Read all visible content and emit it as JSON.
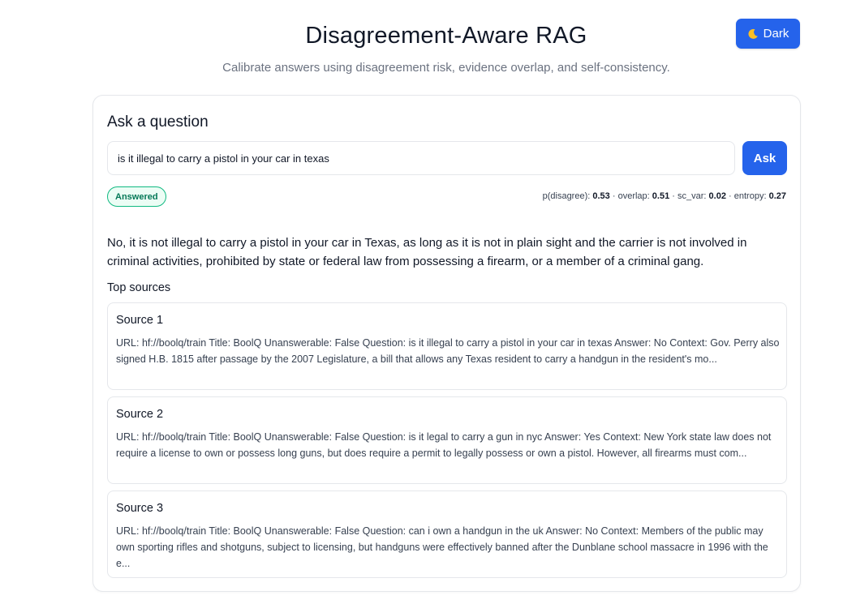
{
  "header": {
    "title": "Disagreement-Aware RAG",
    "subtitle": "Calibrate answers using disagreement risk, evidence overlap, and self-consistency.",
    "theme_toggle_label": "Dark",
    "theme_toggle_icon": "moon-icon"
  },
  "query": {
    "heading": "Ask a question",
    "input_value": "is it illegal to carry a pistol in your car in texas",
    "ask_label": "Ask"
  },
  "status": {
    "badge": "Answered",
    "badge_color": "#047857",
    "metrics": [
      {
        "label": "p(disagree):",
        "value": "0.53"
      },
      {
        "label": "overlap:",
        "value": "0.51"
      },
      {
        "label": "sc_var:",
        "value": "0.02"
      },
      {
        "label": "entropy:",
        "value": "0.27"
      }
    ]
  },
  "answer": "No, it is not illegal to carry a pistol in your car in Texas, as long as it is not in plain sight and the carrier is not involved in criminal activities, prohibited by state or federal law from possessing a firearm, or a member of a criminal gang.",
  "sources": {
    "heading": "Top sources",
    "items": [
      {
        "title": "Source 1",
        "text": "URL: hf://boolq/train Title: BoolQ Unanswerable: False Question: is it illegal to carry a pistol in your car in texas Answer: No Context: Gov. Perry also signed H.B. 1815 after passage by the 2007 Legislature, a bill that allows any Texas resident to carry a handgun in the resident's mo..."
      },
      {
        "title": "Source 2",
        "text": "URL: hf://boolq/train Title: BoolQ Unanswerable: False Question: is it legal to carry a gun in nyc Answer: Yes Context: New York state law does not require a license to own or possess long guns, but does require a permit to legally possess or own a pistol. However, all firearms must com..."
      },
      {
        "title": "Source 3",
        "text": "URL: hf://boolq/train Title: BoolQ Unanswerable: False Question: can i own a handgun in the uk Answer: No Context: Members of the public may own sporting rifles and shotguns, subject to licensing, but handguns were effectively banned after the Dunblane school massacre in 1996 with the e..."
      }
    ]
  },
  "colors": {
    "accent": "#2563eb",
    "badge_border": "#10b981",
    "badge_bg": "#ecfdf5"
  }
}
